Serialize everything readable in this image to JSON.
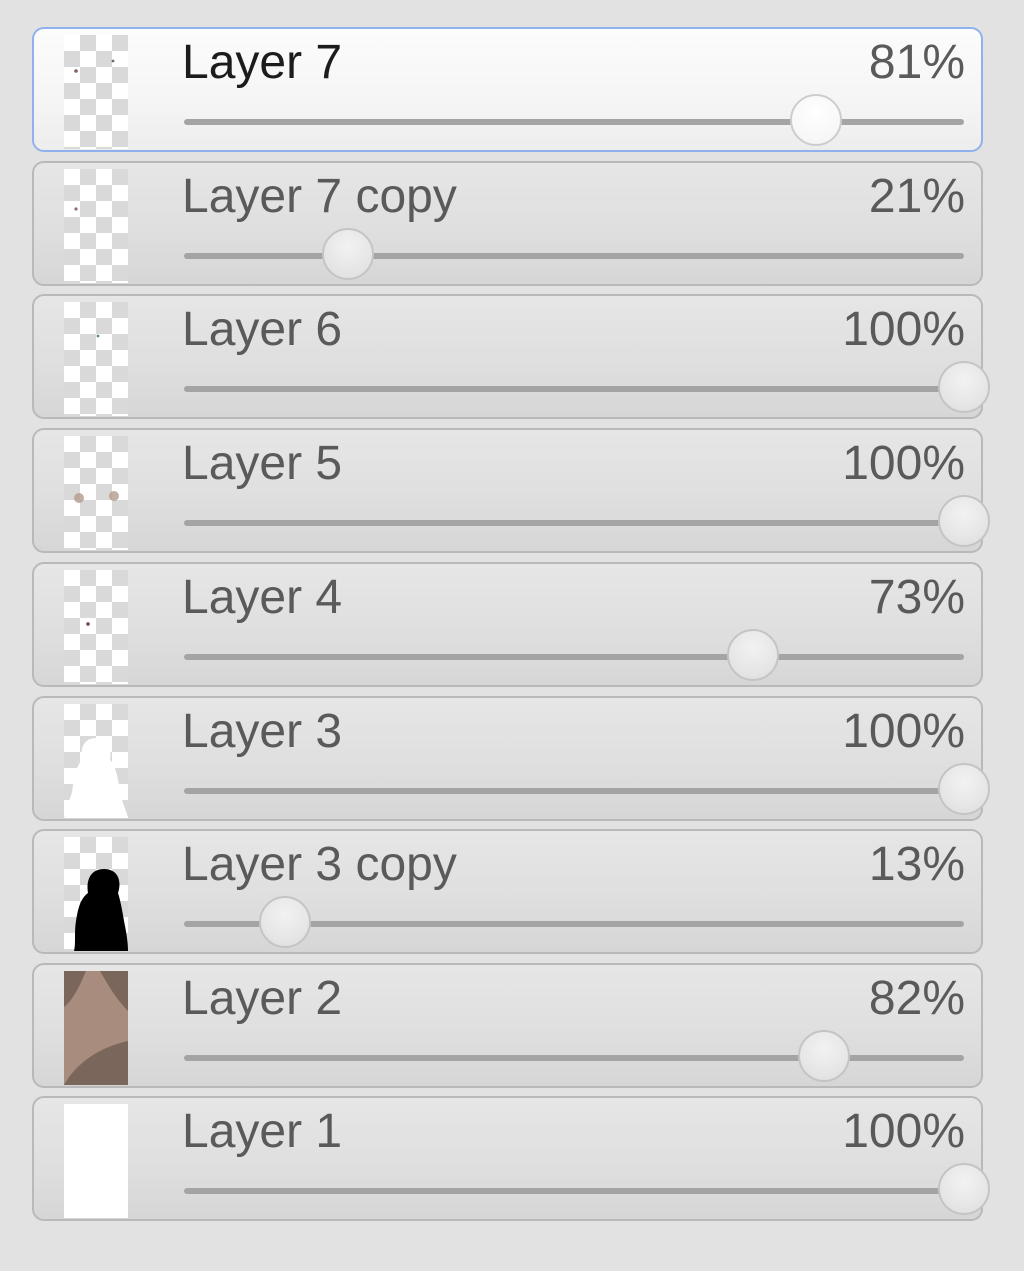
{
  "layers": [
    {
      "name": "Layer 7",
      "opacity_label": "81%",
      "opacity": 0.81,
      "selected": true,
      "thumbnail": "transparent-checker-with-dots"
    },
    {
      "name": "Layer 7 copy",
      "opacity_label": "21%",
      "opacity": 0.21,
      "selected": false,
      "thumbnail": "transparent-checker-with-dot"
    },
    {
      "name": "Layer 6",
      "opacity_label": "100%",
      "opacity": 1.0,
      "selected": false,
      "thumbnail": "transparent-checker-with-dot"
    },
    {
      "name": "Layer 5",
      "opacity_label": "100%",
      "opacity": 1.0,
      "selected": false,
      "thumbnail": "transparent-checker-with-blush"
    },
    {
      "name": "Layer 4",
      "opacity_label": "73%",
      "opacity": 0.73,
      "selected": false,
      "thumbnail": "transparent-checker-with-dot"
    },
    {
      "name": "Layer 3",
      "opacity_label": "100%",
      "opacity": 1.0,
      "selected": false,
      "thumbnail": "white-silhouette"
    },
    {
      "name": "Layer 3 copy",
      "opacity_label": "13%",
      "opacity": 0.13,
      "selected": false,
      "thumbnail": "black-silhouette"
    },
    {
      "name": "Layer 2",
      "opacity_label": "82%",
      "opacity": 0.82,
      "selected": false,
      "thumbnail": "brown-pattern"
    },
    {
      "name": "Layer 1",
      "opacity_label": "100%",
      "opacity": 1.0,
      "selected": false,
      "thumbnail": "solid-white"
    }
  ],
  "colors": {
    "panel_background": "#e2e2e2",
    "selected_border": "#8fb2ee",
    "row_border": "#b9b9b9",
    "slider_track": "#a4a4a4"
  }
}
